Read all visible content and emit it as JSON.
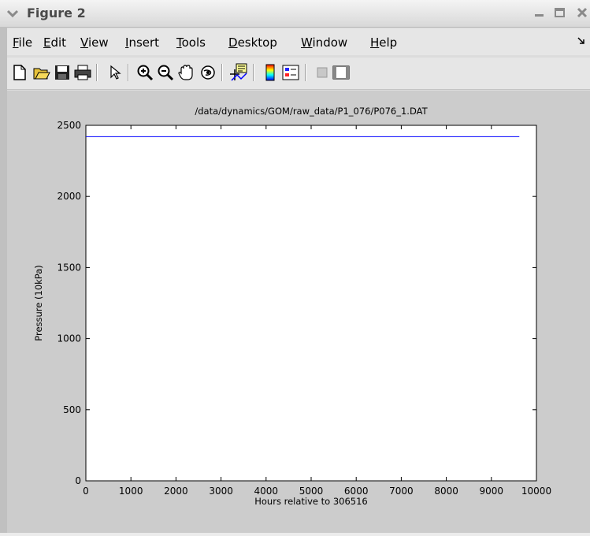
{
  "window": {
    "title": "Figure 2",
    "menu": [
      {
        "label": "File",
        "ul": "F",
        "rest": "ile"
      },
      {
        "label": "Edit",
        "ul": "E",
        "rest": "dit"
      },
      {
        "label": "View",
        "ul": "V",
        "rest": "iew"
      },
      {
        "label": "Insert",
        "ul": "I",
        "rest": "nsert"
      },
      {
        "label": "Tools",
        "ul": "T",
        "rest": "ools"
      },
      {
        "label": "Desktop",
        "ul": "D",
        "rest": "esktop"
      },
      {
        "label": "Window",
        "ul": "W",
        "rest": "indow"
      },
      {
        "label": "Help",
        "ul": "H",
        "rest": "elp"
      }
    ],
    "toolbar": [
      "new-figure-icon",
      "open-file-icon",
      "save-icon",
      "print-icon",
      "pointer-icon",
      "zoom-in-icon",
      "zoom-out-icon",
      "pan-hand-icon",
      "rotate-3d-icon",
      "data-cursor-icon",
      "colorbar-icon",
      "legend-icon",
      "hide-plot-tools-icon",
      "show-plot-tools-icon"
    ]
  },
  "chart_data": {
    "type": "line",
    "title": "/data/dynamics/GOM/raw_data/P1_076/P076_1.DAT",
    "xlabel": "Hours relative to 306516",
    "ylabel": "Pressure (10kPa)",
    "xlim": [
      0,
      10000
    ],
    "ylim": [
      0,
      2500
    ],
    "xticks": [
      "0",
      "1000",
      "2000",
      "3000",
      "4000",
      "5000",
      "6000",
      "7000",
      "8000",
      "9000",
      "10000"
    ],
    "yticks": [
      "0",
      "500",
      "1000",
      "1500",
      "2000",
      "2500"
    ],
    "grid": false,
    "series": [
      {
        "x": [
          0,
          9620
        ],
        "y": [
          2420,
          2420
        ],
        "color": "#0000ff"
      }
    ]
  }
}
